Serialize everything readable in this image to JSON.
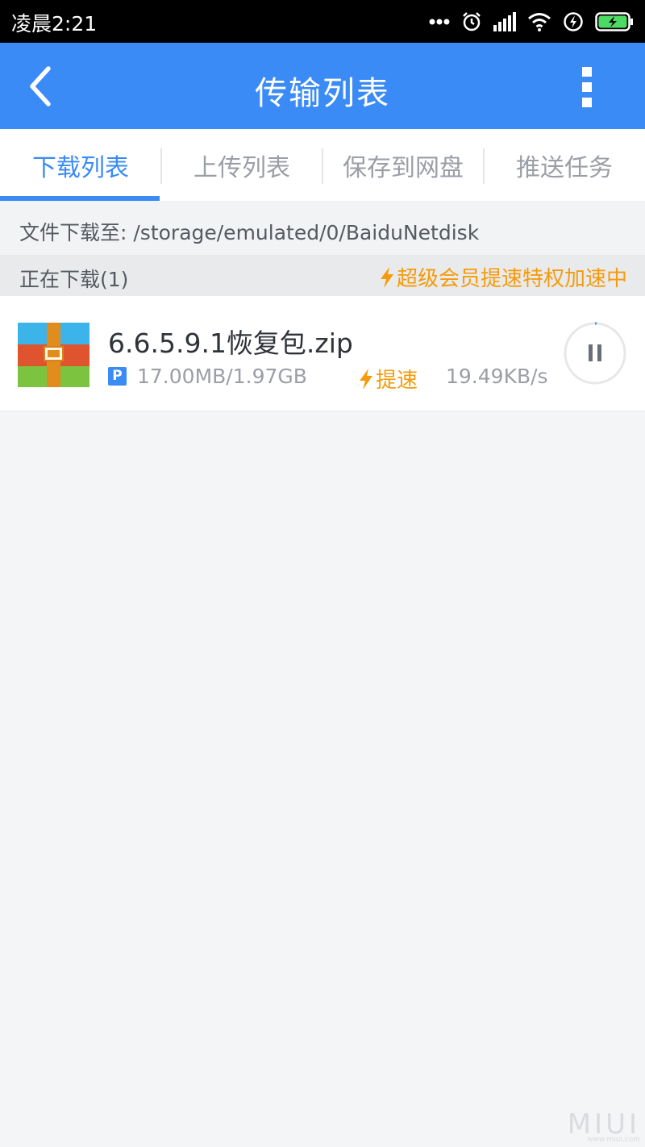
{
  "status_bar": {
    "time": "凌晨2:21",
    "icons": [
      "more-dots-icon",
      "alarm-icon",
      "signal-icon",
      "wifi-icon",
      "charging-icon",
      "battery-icon"
    ]
  },
  "app_bar": {
    "title": "传输列表",
    "back_icon": "chevron-left-icon",
    "more_icon": "more-vertical-icon"
  },
  "tabs": [
    {
      "label": "下载列表",
      "active": true
    },
    {
      "label": "上传列表",
      "active": false
    },
    {
      "label": "保存到网盘",
      "active": false
    },
    {
      "label": "推送任务",
      "active": false
    }
  ],
  "path_bar": {
    "text": "文件下载至: /storage/emulated/0/BaiduNetdisk"
  },
  "section": {
    "title": "正在下载(1)",
    "vip_text": "超级会员提速特权加速中"
  },
  "downloads": [
    {
      "file_name": "6.6.5.9.1恢复包.zip",
      "badge": "P",
      "size": "17.00MB/1.97GB",
      "boost_label": "提速",
      "speed": "19.49KB/s",
      "progress": 0.0086
    }
  ],
  "watermark": {
    "brand": "MIUI",
    "site": "www.miui.com"
  },
  "colors": {
    "accent": "#3a8bf5",
    "boost": "#f59b0b",
    "background": "#f4f5f7"
  }
}
